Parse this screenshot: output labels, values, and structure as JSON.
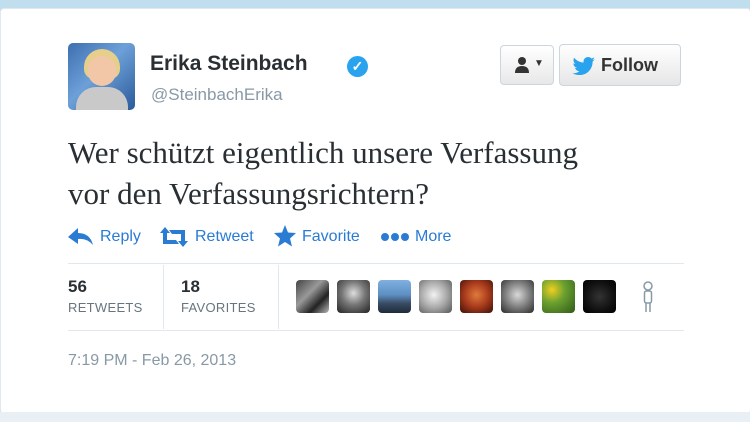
{
  "author": {
    "name": "Erika Steinbach",
    "handle": "@SteinbachErika",
    "verified": true
  },
  "buttons": {
    "follow_label": "Follow"
  },
  "tweet": {
    "text_line1": "Wer schützt eigentlich unsere Verfassung",
    "text_line2": "vor den Verfassungsrichtern?"
  },
  "actions": {
    "reply": "Reply",
    "retweet": "Retweet",
    "favorite": "Favorite",
    "more": "More"
  },
  "stats": {
    "retweets_count": "56",
    "retweets_label": "RETWEETS",
    "favorites_count": "18",
    "favorites_label": "FAVORITES"
  },
  "timestamp": "7:19 PM - Feb 26, 2013",
  "colors": {
    "link": "#2a7bd2",
    "verified": "#2aa3ef",
    "text": "#292f33",
    "muted": "#8899a6",
    "background": "#c0deed"
  },
  "favoriters": [
    {
      "icon": "avatar-collage"
    },
    {
      "icon": "avatar-man-grayscale"
    },
    {
      "icon": "avatar-city-skyline"
    },
    {
      "icon": "avatar-woman-grayscale"
    },
    {
      "icon": "avatar-red-portrait"
    },
    {
      "icon": "avatar-man-glasses"
    },
    {
      "icon": "avatar-yellow-flowers"
    },
    {
      "icon": "avatar-black-cat"
    }
  ]
}
